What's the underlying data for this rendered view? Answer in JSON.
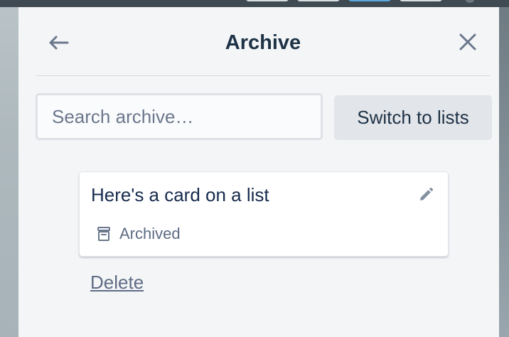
{
  "archive_panel": {
    "title": "Archive",
    "back_icon": "arrow-left-icon",
    "close_icon": "close-icon"
  },
  "search": {
    "placeholder": "Search archive…",
    "value": ""
  },
  "switch_button": {
    "label": "Switch to lists"
  },
  "archived_cards": [
    {
      "title": "Here's a card on a list",
      "status": "Archived",
      "status_icon": "archive-box-icon",
      "edit_icon": "pencil-icon",
      "delete_label": "Delete"
    }
  ],
  "colors": {
    "title_text": "#1e3246",
    "panel_background": "#f4f5f7",
    "muted_text": "#5e6c84",
    "button_background": "#e2e5e9"
  }
}
